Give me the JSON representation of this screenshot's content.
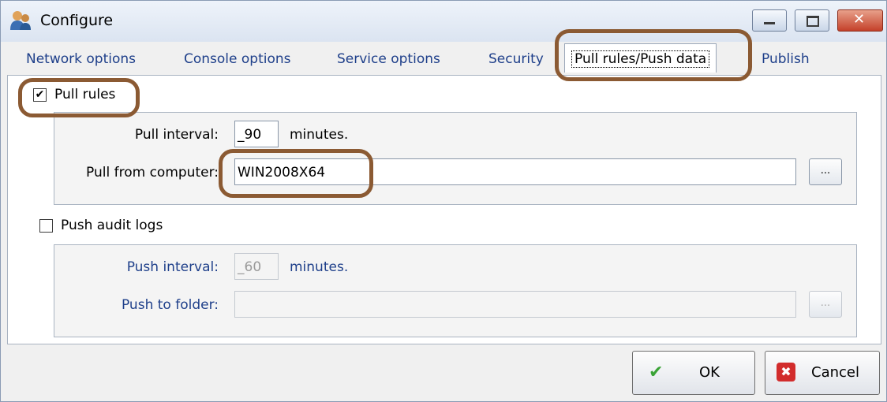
{
  "window": {
    "title": "Configure"
  },
  "title_controls": {
    "min_icon": "minimize-icon",
    "max_icon": "maximize-icon",
    "close_icon": "close-icon",
    "close_glyph": "✕"
  },
  "tabs": [
    {
      "label": "Network options"
    },
    {
      "label": "Console options"
    },
    {
      "label": "Service options"
    },
    {
      "label": "Security"
    },
    {
      "label": "Pull rules/Push data",
      "active": true
    },
    {
      "label": "Publish"
    }
  ],
  "pull": {
    "checkbox_label": "Pull rules",
    "checked": true,
    "check_glyph": "✔",
    "interval_label": "Pull interval:",
    "interval_value": "_90",
    "interval_unit": "minutes.",
    "computer_label": "Pull from computer:",
    "computer_value": "WIN2008X64",
    "browse_label": "..."
  },
  "push": {
    "checkbox_label": "Push audit logs",
    "checked": false,
    "interval_label": "Push interval:",
    "interval_value": "_60",
    "interval_unit": "minutes.",
    "folder_label": "Push to folder:",
    "folder_value": "",
    "browse_label": "..."
  },
  "buttons": {
    "ok_label": "OK",
    "ok_glyph": "✔",
    "cancel_label": "Cancel",
    "cancel_glyph": "✖"
  },
  "colors": {
    "label_blue": "#1e3f8a",
    "annotation_brown": "#8b5a33",
    "ok_green": "#3aa336",
    "cancel_red": "#d22c2c"
  }
}
